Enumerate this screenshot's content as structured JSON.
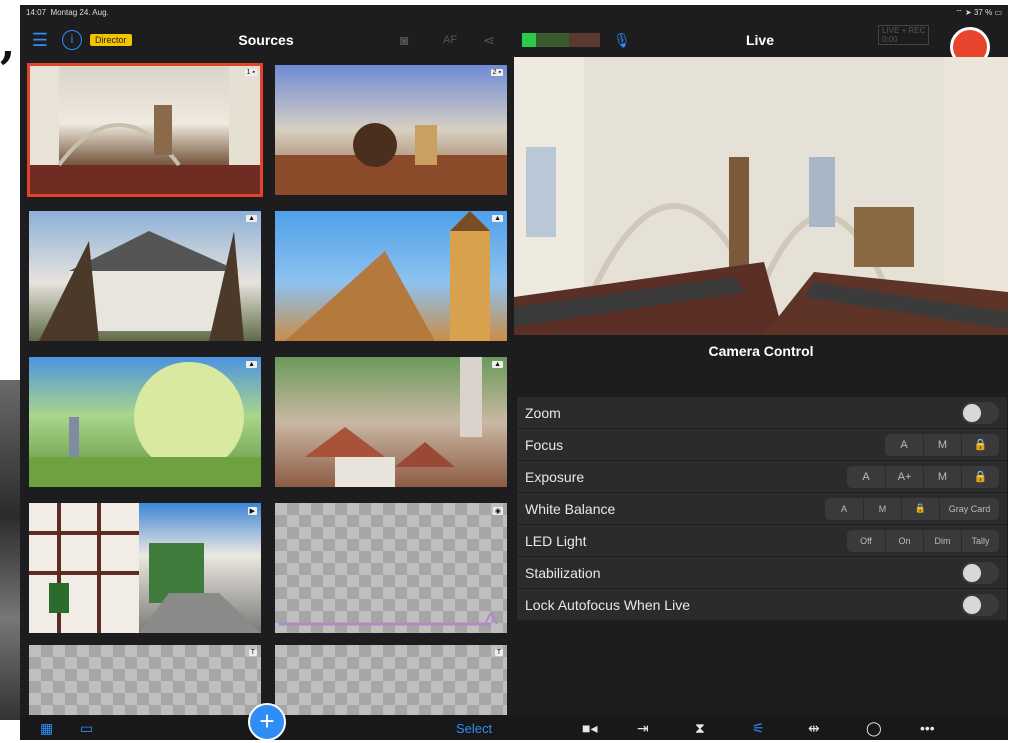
{
  "status": {
    "time": "14:07",
    "date": "Montag 24. Aug.",
    "battery": "37 %",
    "signal_icon": "wifi-icon"
  },
  "left_header": {
    "title": "Sources",
    "mode_badge": "Director",
    "af_label": "AF"
  },
  "right_header": {
    "title": "Live",
    "live_rec_label": "LIVE + REC",
    "live_rec_time": "0:00"
  },
  "sources": [
    {
      "tag": "1 ▪",
      "kind": "camera",
      "scene": "church-nave",
      "selected": true
    },
    {
      "tag": "2 ▪",
      "kind": "camera",
      "scene": "church-organ"
    },
    {
      "tag": "▲",
      "kind": "image",
      "scene": "church-exterior-trees"
    },
    {
      "tag": "▲",
      "kind": "image",
      "scene": "church-tower-sky"
    },
    {
      "tag": "▲",
      "kind": "image",
      "scene": "blossom-tree-town"
    },
    {
      "tag": "▲",
      "kind": "image",
      "scene": "aerial-town"
    },
    {
      "tag": "▶",
      "kind": "video",
      "scene": "timber-frame-street"
    },
    {
      "tag": "◉",
      "kind": "audio",
      "scene": "empty-waveform"
    },
    {
      "tag": "T",
      "kind": "title",
      "scene": "empty"
    },
    {
      "tag": "T",
      "kind": "title",
      "scene": "empty"
    }
  ],
  "camera_control": {
    "title": "Camera Control",
    "rows": [
      {
        "label": "Zoom",
        "control": "toggle"
      },
      {
        "label": "Focus",
        "control": "segment",
        "options": [
          "A",
          "M",
          "🔒"
        ]
      },
      {
        "label": "Exposure",
        "control": "segment",
        "options": [
          "A",
          "A+",
          "M",
          "🔒"
        ]
      },
      {
        "label": "White Balance",
        "control": "segment",
        "options": [
          "A",
          "M",
          "🔒",
          "Gray Card"
        ]
      },
      {
        "label": "LED Light",
        "control": "segment",
        "options": [
          "Off",
          "On",
          "Dim",
          "Tally"
        ]
      },
      {
        "label": "Stabilization",
        "control": "toggle"
      },
      {
        "label": "Lock Autofocus When Live",
        "control": "toggle"
      }
    ]
  },
  "bottom": {
    "select_label": "Select",
    "add_label": "+"
  },
  "colors": {
    "accent": "#2f8df5",
    "record": "#e9442e",
    "selection": "#e2432a",
    "panel": "#2b2b2d",
    "background": "#1d1d1f"
  }
}
